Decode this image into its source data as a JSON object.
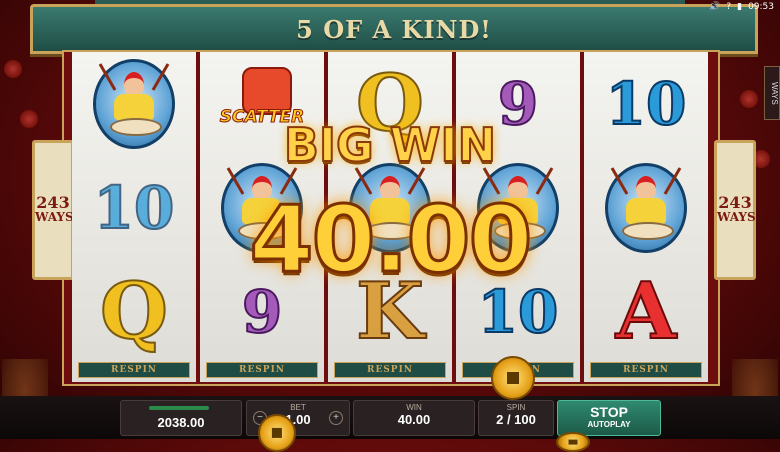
{
  "status": {
    "time": "09:53",
    "sound_icon": "speaker-icon",
    "help_icon": "question-icon"
  },
  "banner": {
    "title": "5 OF A KIND!"
  },
  "side_panels": {
    "left": {
      "number": "243",
      "label": "WAYS"
    },
    "right": {
      "number": "243",
      "label": "WAYS"
    },
    "tab": "WAYS"
  },
  "reels": [
    {
      "symbols": [
        "drummer",
        "10",
        "Q"
      ],
      "respin": "RESPIN"
    },
    {
      "symbols": [
        "scatter",
        "drummer",
        "9"
      ],
      "respin": "RESPIN"
    },
    {
      "symbols": [
        "Q",
        "drummer",
        "K"
      ],
      "respin": "RESPIN"
    },
    {
      "symbols": [
        "9",
        "drummer",
        "10"
      ],
      "respin": "RESPIN"
    },
    {
      "symbols": [
        "10",
        "drummer",
        "A"
      ],
      "respin": "RESPIN"
    }
  ],
  "scatter_label": "SCATTER",
  "win": {
    "headline": "BIG WIN",
    "amount": "40.00"
  },
  "hud": {
    "balance": "2038.00",
    "bet_label": "BET",
    "bet_value": "1.00",
    "win_label": "WIN",
    "win_value": "40.00",
    "spin_label": "SPIN",
    "spin_value": "2 / 100",
    "stop_label": "STOP",
    "autoplay_label": "AUTOPLAY",
    "bet_minus": "−",
    "bet_plus": "+"
  },
  "colors": {
    "roof": "#1f4d46",
    "trim": "#c9a35a",
    "win_gold": "#ffcf3a"
  }
}
